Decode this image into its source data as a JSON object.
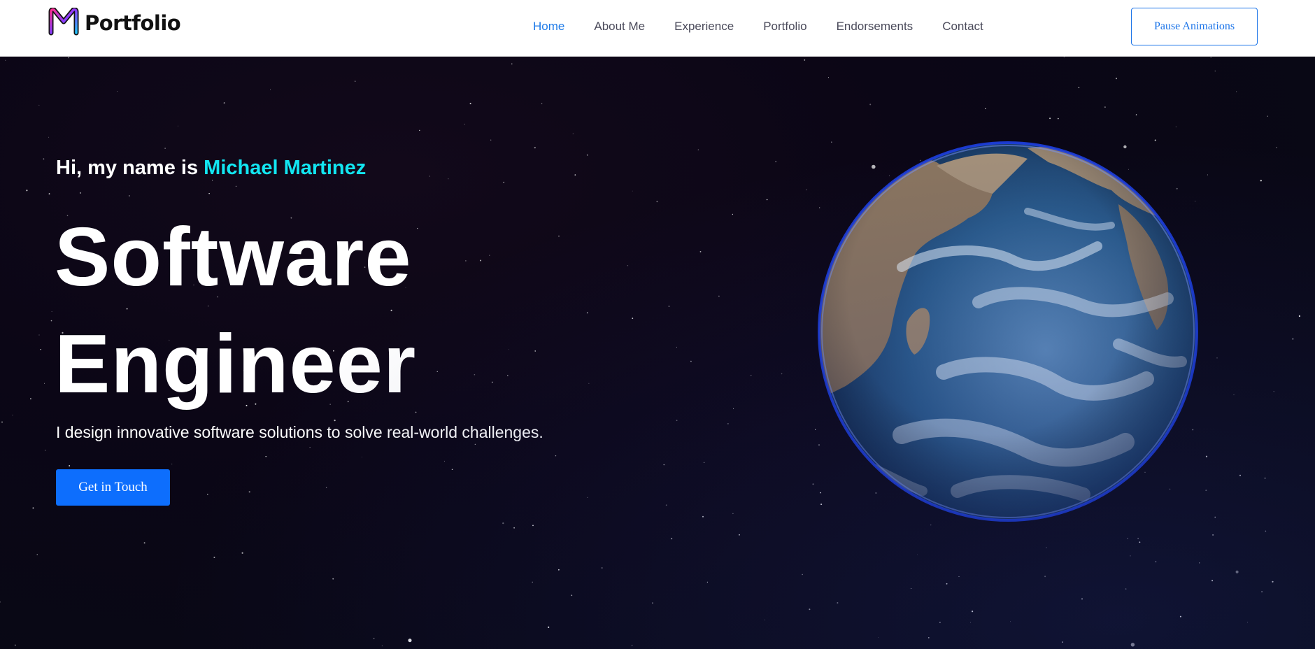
{
  "nav": {
    "brand": "Portfolio",
    "links": [
      {
        "label": "Home",
        "active": true
      },
      {
        "label": "About Me"
      },
      {
        "label": "Experience"
      },
      {
        "label": "Portfolio"
      },
      {
        "label": "Endorsements"
      },
      {
        "label": "Contact"
      }
    ],
    "pause_label": "Pause Animations"
  },
  "hero": {
    "intro_prefix": "Hi, my name is ",
    "name": "Michael Martinez",
    "title_line1": "Software",
    "title_line2": "Engineer",
    "description": "I design innovative software solutions to solve real-world challenges.",
    "cta_label": "Get in Touch"
  },
  "colors": {
    "accent": "#0d6efd",
    "name_highlight": "#12e6f2",
    "nav_active": "#1f7be8",
    "hero_bg": "#0b0616"
  },
  "icons": {
    "logo": "m-logo-icon",
    "globe": "earth-globe"
  }
}
